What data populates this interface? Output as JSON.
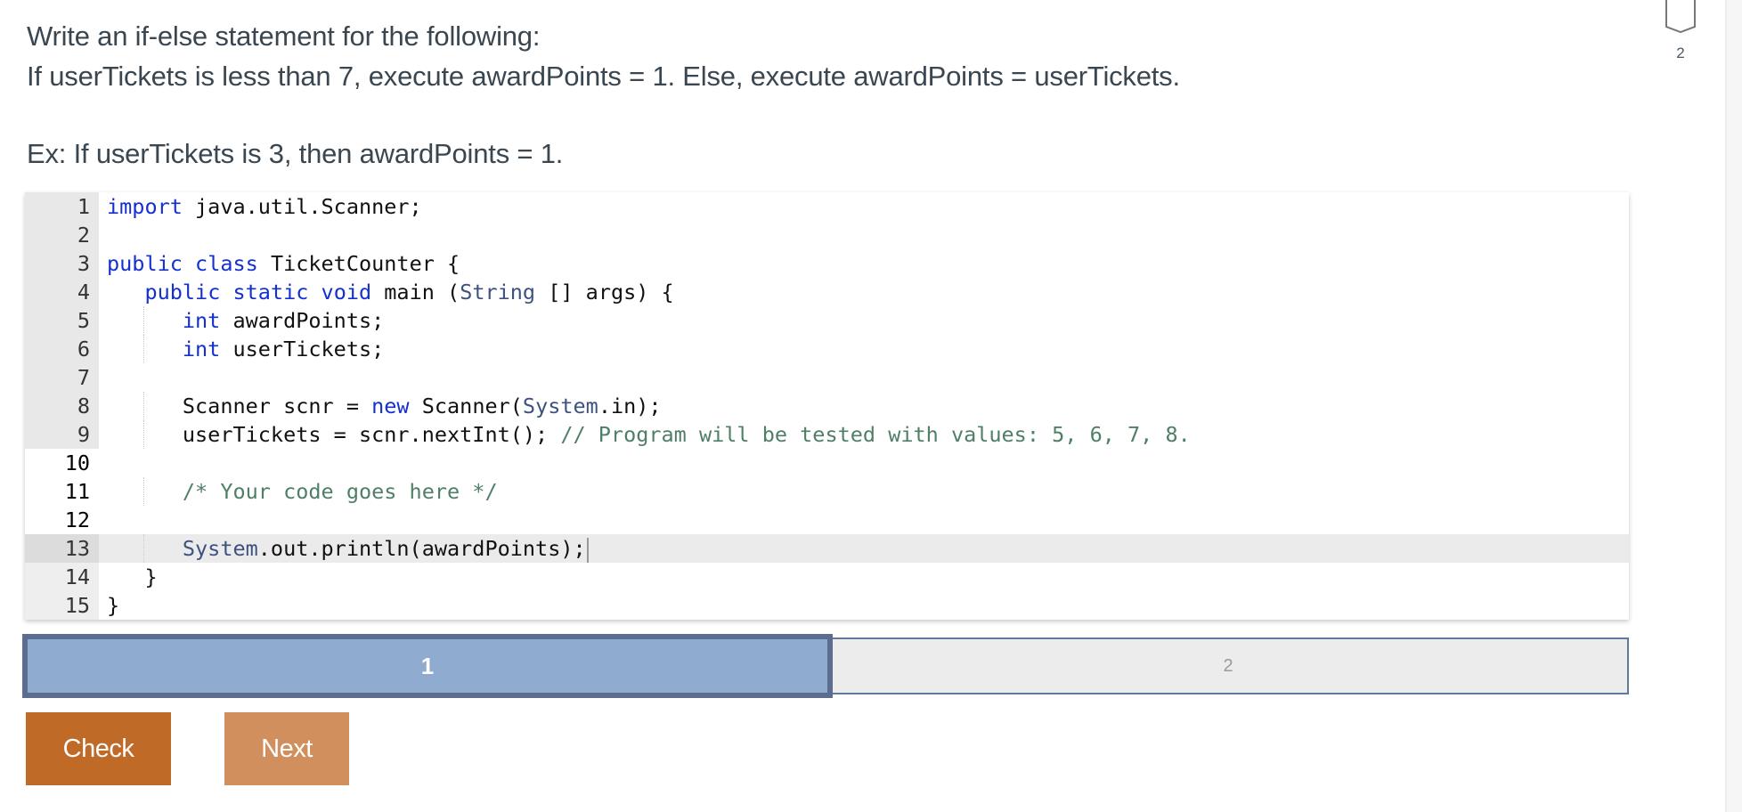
{
  "prompt": {
    "line1": "Write an if-else statement for the following:",
    "line2": "If userTickets is less than 7, execute awardPoints = 1. Else, execute awardPoints = userTickets.",
    "example": "Ex: If userTickets is 3, then awardPoints = 1."
  },
  "badge": {
    "icon": "bookmark-icon",
    "count": "2"
  },
  "editor": {
    "language": "java",
    "active_line": 13,
    "editable_lines": [
      10,
      11,
      12
    ],
    "lines": [
      {
        "n": "1",
        "tokens": [
          [
            "kw",
            "import"
          ],
          [
            "",
            " java.util.Scanner;"
          ]
        ]
      },
      {
        "n": "2",
        "tokens": []
      },
      {
        "n": "3",
        "tokens": [
          [
            "kw",
            "public"
          ],
          [
            "",
            " "
          ],
          [
            "kw",
            "class"
          ],
          [
            "",
            " TicketCounter {"
          ]
        ]
      },
      {
        "n": "4",
        "tokens": [
          [
            "",
            "   "
          ],
          [
            "kw",
            "public"
          ],
          [
            "",
            " "
          ],
          [
            "kw",
            "static"
          ],
          [
            "",
            " "
          ],
          [
            "kw",
            "void"
          ],
          [
            "",
            " main ("
          ],
          [
            "ty",
            "String"
          ],
          [
            "",
            " [] args) {"
          ]
        ]
      },
      {
        "n": "5",
        "tokens": [
          [
            "",
            "      "
          ],
          [
            "kw",
            "int"
          ],
          [
            "",
            " awardPoints;"
          ]
        ]
      },
      {
        "n": "6",
        "tokens": [
          [
            "",
            "      "
          ],
          [
            "kw",
            "int"
          ],
          [
            "",
            " userTickets;"
          ]
        ]
      },
      {
        "n": "7",
        "tokens": []
      },
      {
        "n": "8",
        "tokens": [
          [
            "",
            "      Scanner scnr = "
          ],
          [
            "kw",
            "new"
          ],
          [
            "",
            " Scanner("
          ],
          [
            "ty",
            "System"
          ],
          [
            "",
            ".in);"
          ]
        ]
      },
      {
        "n": "9",
        "tokens": [
          [
            "",
            "      userTickets = scnr.nextInt(); "
          ],
          [
            "cm",
            "// Program will be tested with values: 5, 6, 7, 8."
          ]
        ]
      },
      {
        "n": "10",
        "tokens": []
      },
      {
        "n": "11",
        "tokens": [
          [
            "",
            "      "
          ],
          [
            "cm",
            "/* Your code goes here */"
          ]
        ]
      },
      {
        "n": "12",
        "tokens": []
      },
      {
        "n": "13",
        "tokens": [
          [
            "",
            "      "
          ],
          [
            "ty",
            "System"
          ],
          [
            "",
            ".out.println(awardPoints);"
          ]
        ]
      },
      {
        "n": "14",
        "tokens": [
          [
            "",
            "   }"
          ]
        ]
      },
      {
        "n": "15",
        "tokens": [
          [
            "",
            "}"
          ]
        ]
      }
    ]
  },
  "progress": {
    "current": 1,
    "total": 2,
    "segments": [
      {
        "label": "1",
        "state": "active"
      },
      {
        "label": "2",
        "state": "inactive"
      }
    ]
  },
  "buttons": {
    "check": "Check",
    "next": "Next"
  },
  "colors": {
    "check_button": "#c06a28",
    "next_button": "#d08f5c",
    "progress_active_fill": "#8facd0",
    "progress_active_border": "#5b6e8f",
    "keyword": "#1530d0",
    "type": "#3e5280",
    "comment": "#4f7f66"
  }
}
